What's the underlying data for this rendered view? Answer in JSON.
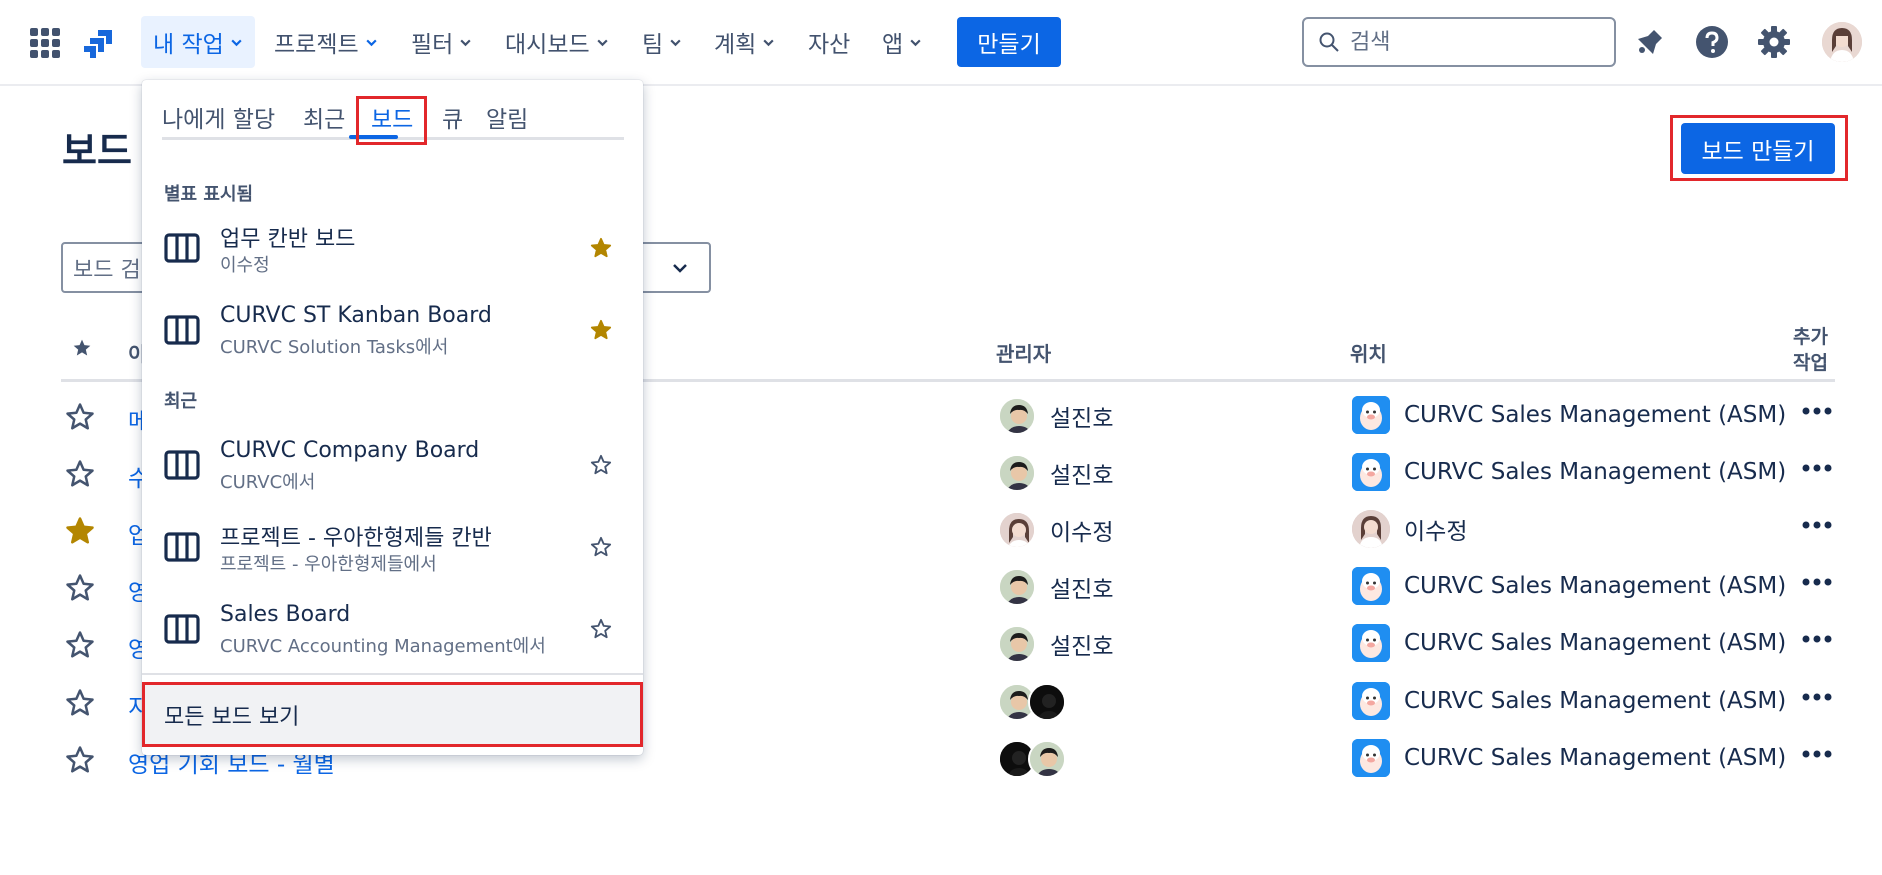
{
  "nav": {
    "items": [
      {
        "label": "내 작업",
        "has_chevron": true,
        "active": true
      },
      {
        "label": "프로젝트",
        "has_chevron": true
      },
      {
        "label": "필터",
        "has_chevron": true
      },
      {
        "label": "대시보드",
        "has_chevron": true
      },
      {
        "label": "팀",
        "has_chevron": true
      },
      {
        "label": "계획",
        "has_chevron": true
      },
      {
        "label": "자산",
        "has_chevron": false
      },
      {
        "label": "앱",
        "has_chevron": true
      }
    ],
    "create_label": "만들기",
    "search_placeholder": "검색",
    "accent_color": "#0c66e4"
  },
  "page": {
    "title": "보드",
    "create_board_label": "보드 만들기",
    "filter_placeholder": "보드 검"
  },
  "table": {
    "headers": {
      "name": "이",
      "admin": "관리자",
      "location": "위치",
      "actions": "추가 작업"
    },
    "rows": [
      {
        "name": "메",
        "starred": false,
        "admin": "설진호",
        "location": "CURVC Sales Management (ASM)",
        "location_type": "project"
      },
      {
        "name": "수",
        "starred": false,
        "admin": "설진호",
        "location": "CURVC Sales Management (ASM)",
        "location_type": "project"
      },
      {
        "name": "업",
        "starred": true,
        "admin": "이수정",
        "location": "이수정",
        "location_type": "person"
      },
      {
        "name": "영",
        "starred": false,
        "admin": "설진호",
        "location": "CURVC Sales Management (ASM)",
        "location_type": "project"
      },
      {
        "name": "영",
        "starred": false,
        "admin": "설진호",
        "location": "CURVC Sales Management (ASM)",
        "location_type": "project"
      },
      {
        "name": "지출 내역 보드",
        "starred": false,
        "admin": "",
        "location": "CURVC Sales Management (ASM)",
        "location_type": "project"
      },
      {
        "name": "영업 기회 보드 - 월별",
        "starred": false,
        "admin": "",
        "location": "CURVC Sales Management (ASM)",
        "location_type": "project"
      }
    ]
  },
  "dropdown": {
    "tabs": [
      "나에게 할당",
      "최근",
      "보드",
      "큐",
      "알림"
    ],
    "active_tab": "보드",
    "starred_section": "별표 표시됨",
    "recent_section": "최근",
    "starred": [
      {
        "name": "업무 칸반 보드",
        "sub": "이수정",
        "starred": true
      },
      {
        "name": "CURVC ST Kanban Board",
        "sub": "CURVC Solution Tasks에서",
        "starred": true
      }
    ],
    "recent": [
      {
        "name": "CURVC Company Board",
        "sub": "CURVC에서",
        "starred": false
      },
      {
        "name": "프로젝트 - 우아한형제들 칸반",
        "sub": "프로젝트 - 우아한형제들에서",
        "starred": false
      },
      {
        "name": "Sales Board",
        "sub": "CURVC Accounting Management에서",
        "starred": false
      }
    ],
    "footer": "모든 보드 보기"
  },
  "colors": {
    "star_filled": "#b38600",
    "link": "#0c66e4",
    "highlight_box": "#e2272b"
  }
}
